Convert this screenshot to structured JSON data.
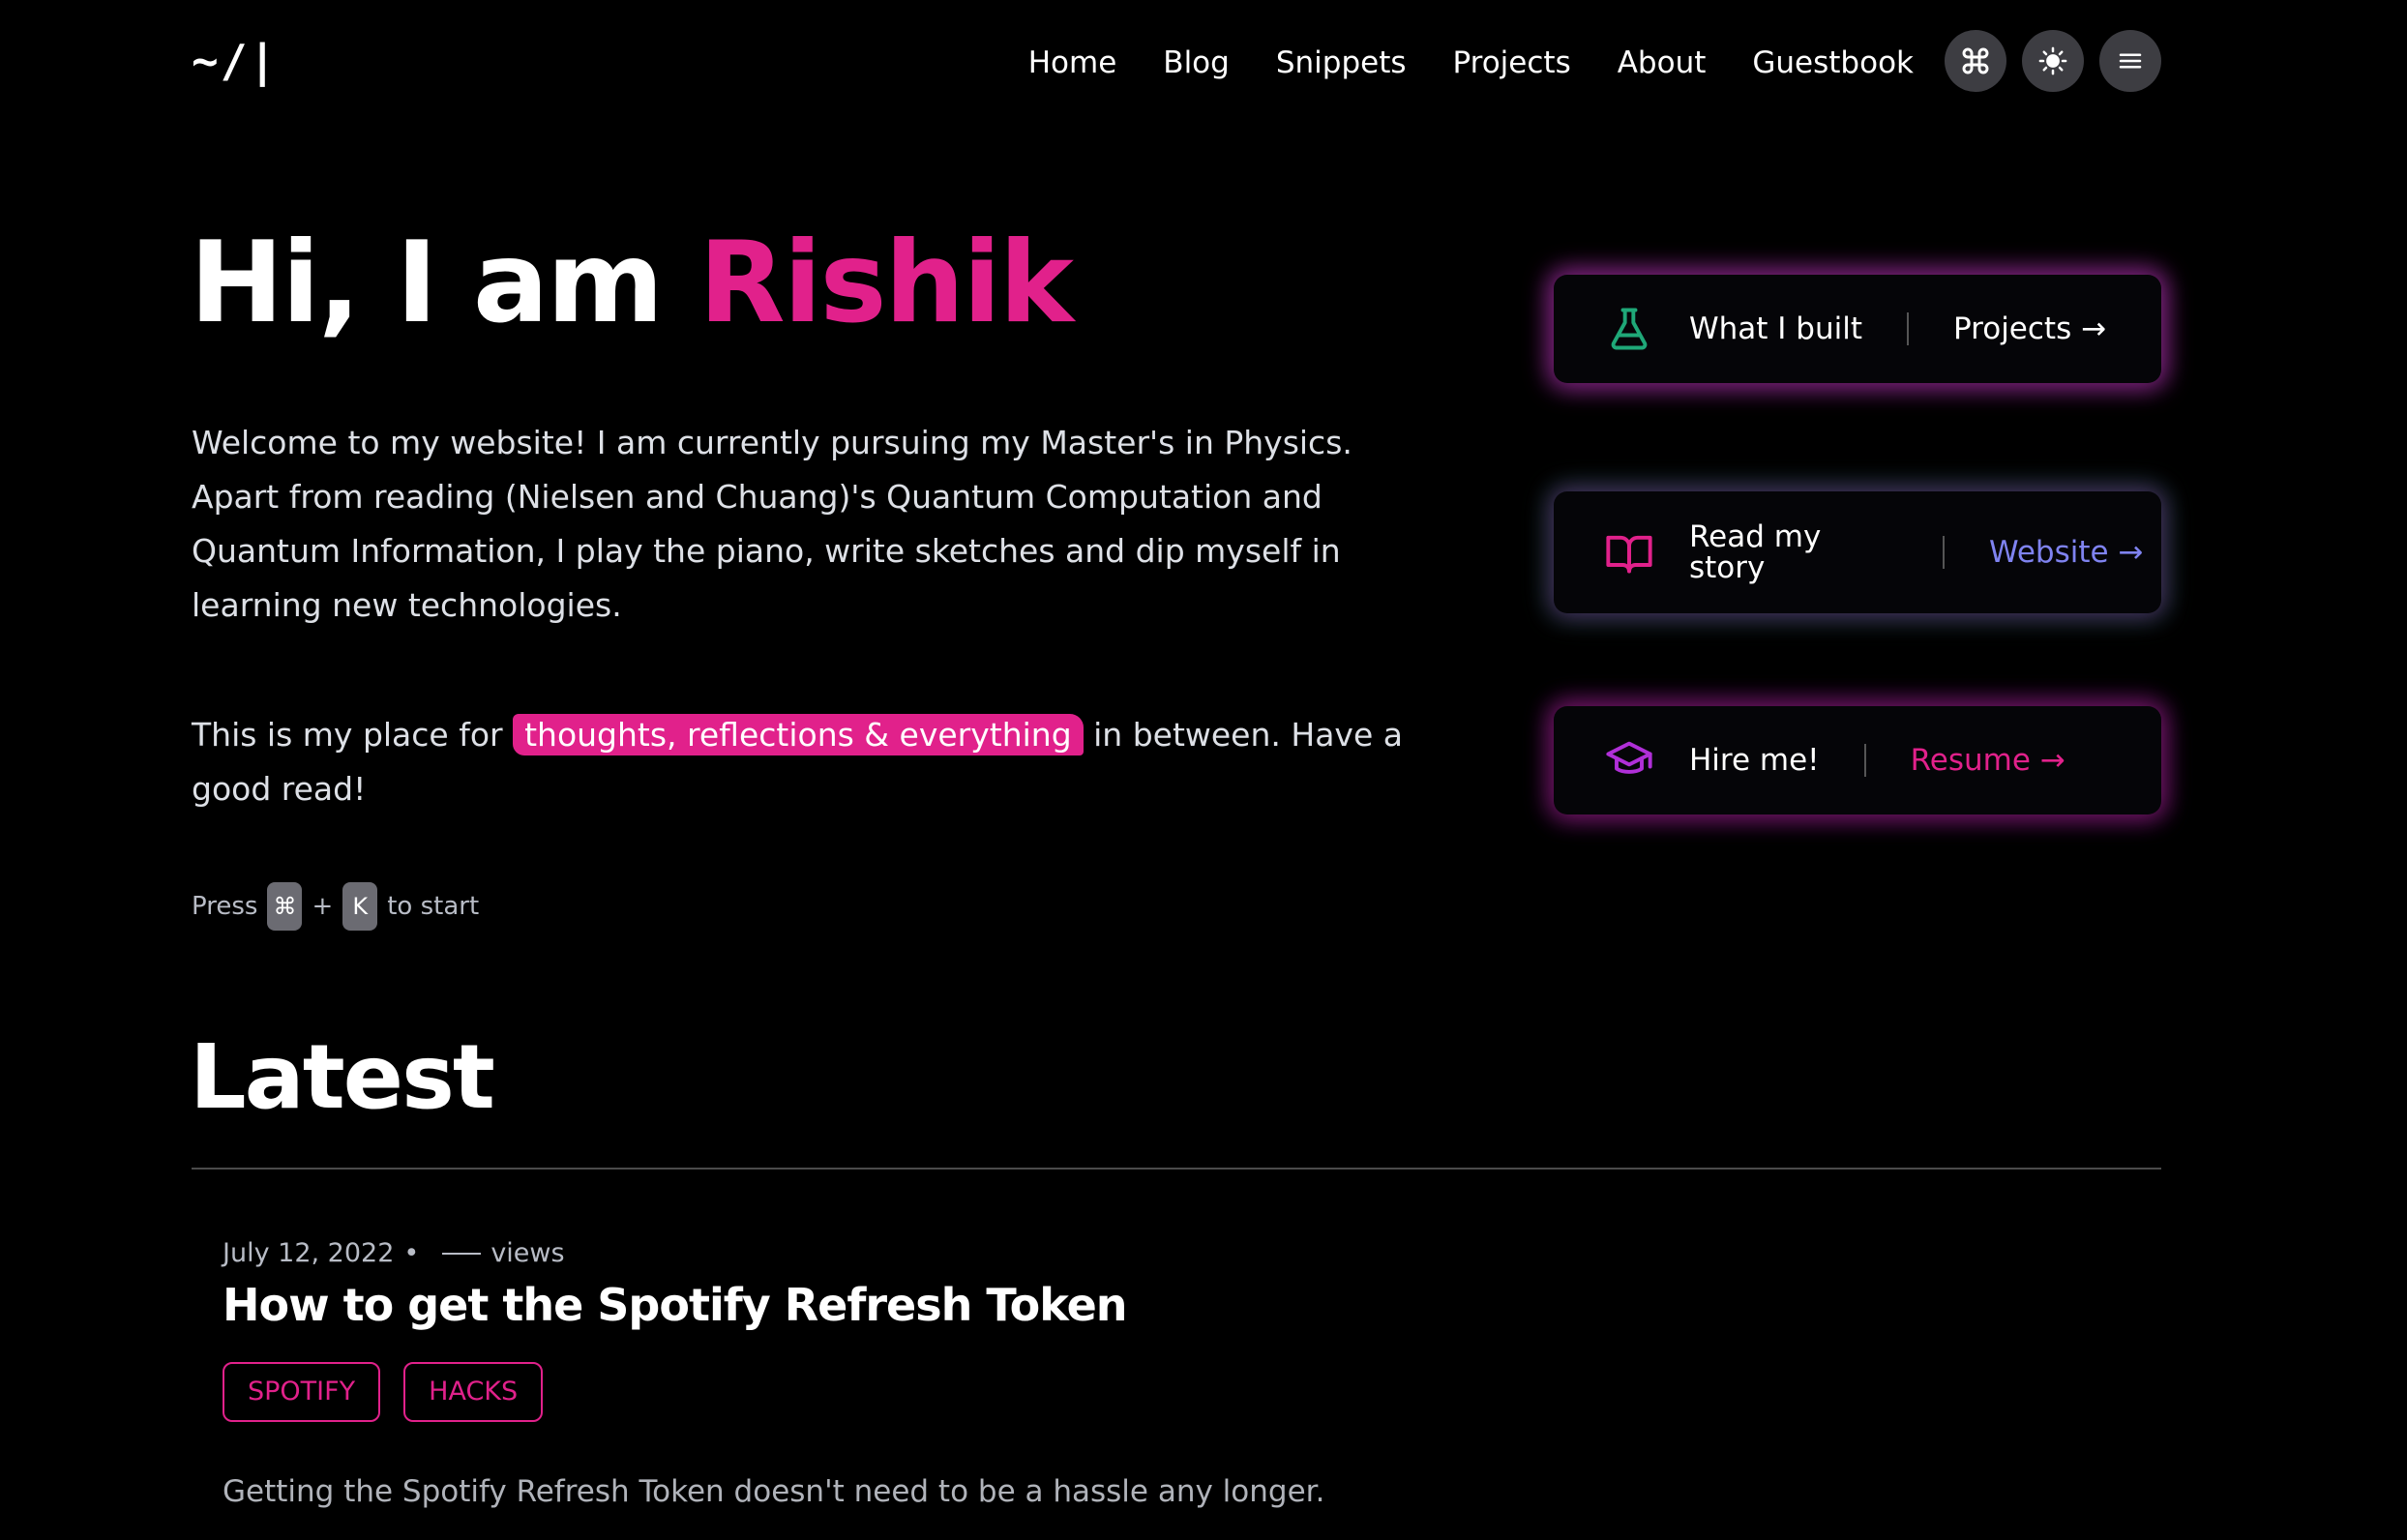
{
  "header": {
    "logo": "~/|",
    "nav": [
      "Home",
      "Blog",
      "Snippets",
      "Projects",
      "About",
      "Guestbook"
    ],
    "icons": [
      "command-icon",
      "sun-icon",
      "menu-icon"
    ]
  },
  "hero": {
    "greeting": "Hi, I am ",
    "name": "Rishik",
    "intro": "Welcome to my website! I am currently pursuing my Master's in Physics. Apart from reading (Nielsen and Chuang)'s Quantum Computation and Quantum Information, I play the piano, write sketches and dip myself in learning new technologies.",
    "intro2_before": "This is my place for ",
    "intro2_highlight": "thoughts, reflections & everything",
    "intro2_after": " in between. Have a good read!",
    "press_label": "Press",
    "key1": "⌘",
    "plus": "+",
    "key2": "K",
    "press_suffix": "to start"
  },
  "cards": [
    {
      "icon": "flask-icon",
      "label": "What I built",
      "link": "Projects →",
      "link_color": "#ffffff",
      "icon_color": "#1fa878"
    },
    {
      "icon": "book-open-icon",
      "label": "Read my story",
      "link": "Website →",
      "link_color": "#7f83f0",
      "icon_color": "#e1218b"
    },
    {
      "icon": "graduation-cap-icon",
      "label": "Hire me!",
      "link": "Resume →",
      "link_color": "#e1218b",
      "icon_color": "#b02fd8"
    }
  ],
  "latest": {
    "heading": "Latest",
    "post": {
      "date": "July 12, 2022",
      "bullet": "•",
      "views_label": "views",
      "title": "How to get the Spotify Refresh Token",
      "tags": [
        "SPOTIFY",
        "HACKS"
      ],
      "excerpt": "Getting the Spotify Refresh Token doesn't need to be a hassle any longer."
    }
  },
  "colors": {
    "accent": "#e1218b",
    "background": "#000000"
  }
}
